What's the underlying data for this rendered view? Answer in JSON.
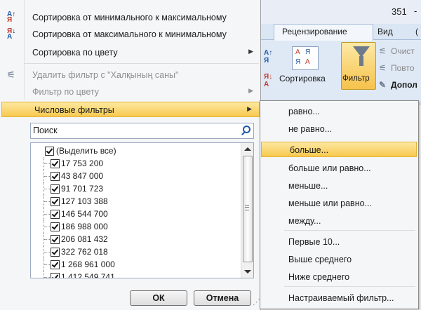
{
  "ribbon": {
    "title_fragment": "351",
    "title_sep": "-",
    "tabs": [
      "Рецензирование",
      "Вид",
      "("
    ],
    "sort_label": "Сортировка",
    "filter_label": "Фильтр",
    "right_commands": [
      "Очист",
      "Повто",
      "Допол"
    ]
  },
  "menu": {
    "items": [
      {
        "label": "Сортировка от минимального к максимальному",
        "icon": "sort-ascending-icon"
      },
      {
        "label": "Сортировка от максимального к минимальному",
        "icon": "sort-descending-icon"
      },
      {
        "label": "Сортировка по цвету",
        "icon": ""
      },
      {
        "label": "Удалить фильтр с \"Халқының саны\"",
        "icon": "clear-filter-icon"
      },
      {
        "label": "Фильтр по цвету",
        "icon": ""
      },
      {
        "label": "Числовые фильтры",
        "icon": ""
      }
    ],
    "search_placeholder": "Поиск",
    "list": [
      "(Выделить все)",
      "17 753 200",
      "43 847 000",
      "91 701 723",
      "127 103 388",
      "146 544 700",
      "186 988 000",
      "206 081 432",
      "322 762 018",
      "1 268 961 000",
      "1 412 549 741"
    ],
    "ok_label": "ОК",
    "cancel_label": "Отмена"
  },
  "submenu": {
    "items": [
      "равно...",
      "не равно...",
      "больше...",
      "больше или равно...",
      "меньше...",
      "меньше или равно...",
      "между...",
      "Первые 10...",
      "Выше среднего",
      "Ниже среднего",
      "Настраиваемый фильтр..."
    ],
    "highlighted": "больше..."
  },
  "colors": {
    "highlight": "#f7c94f",
    "menu_bg": "#f5f6f8",
    "ribbon_bg": "#dfe9f5"
  }
}
